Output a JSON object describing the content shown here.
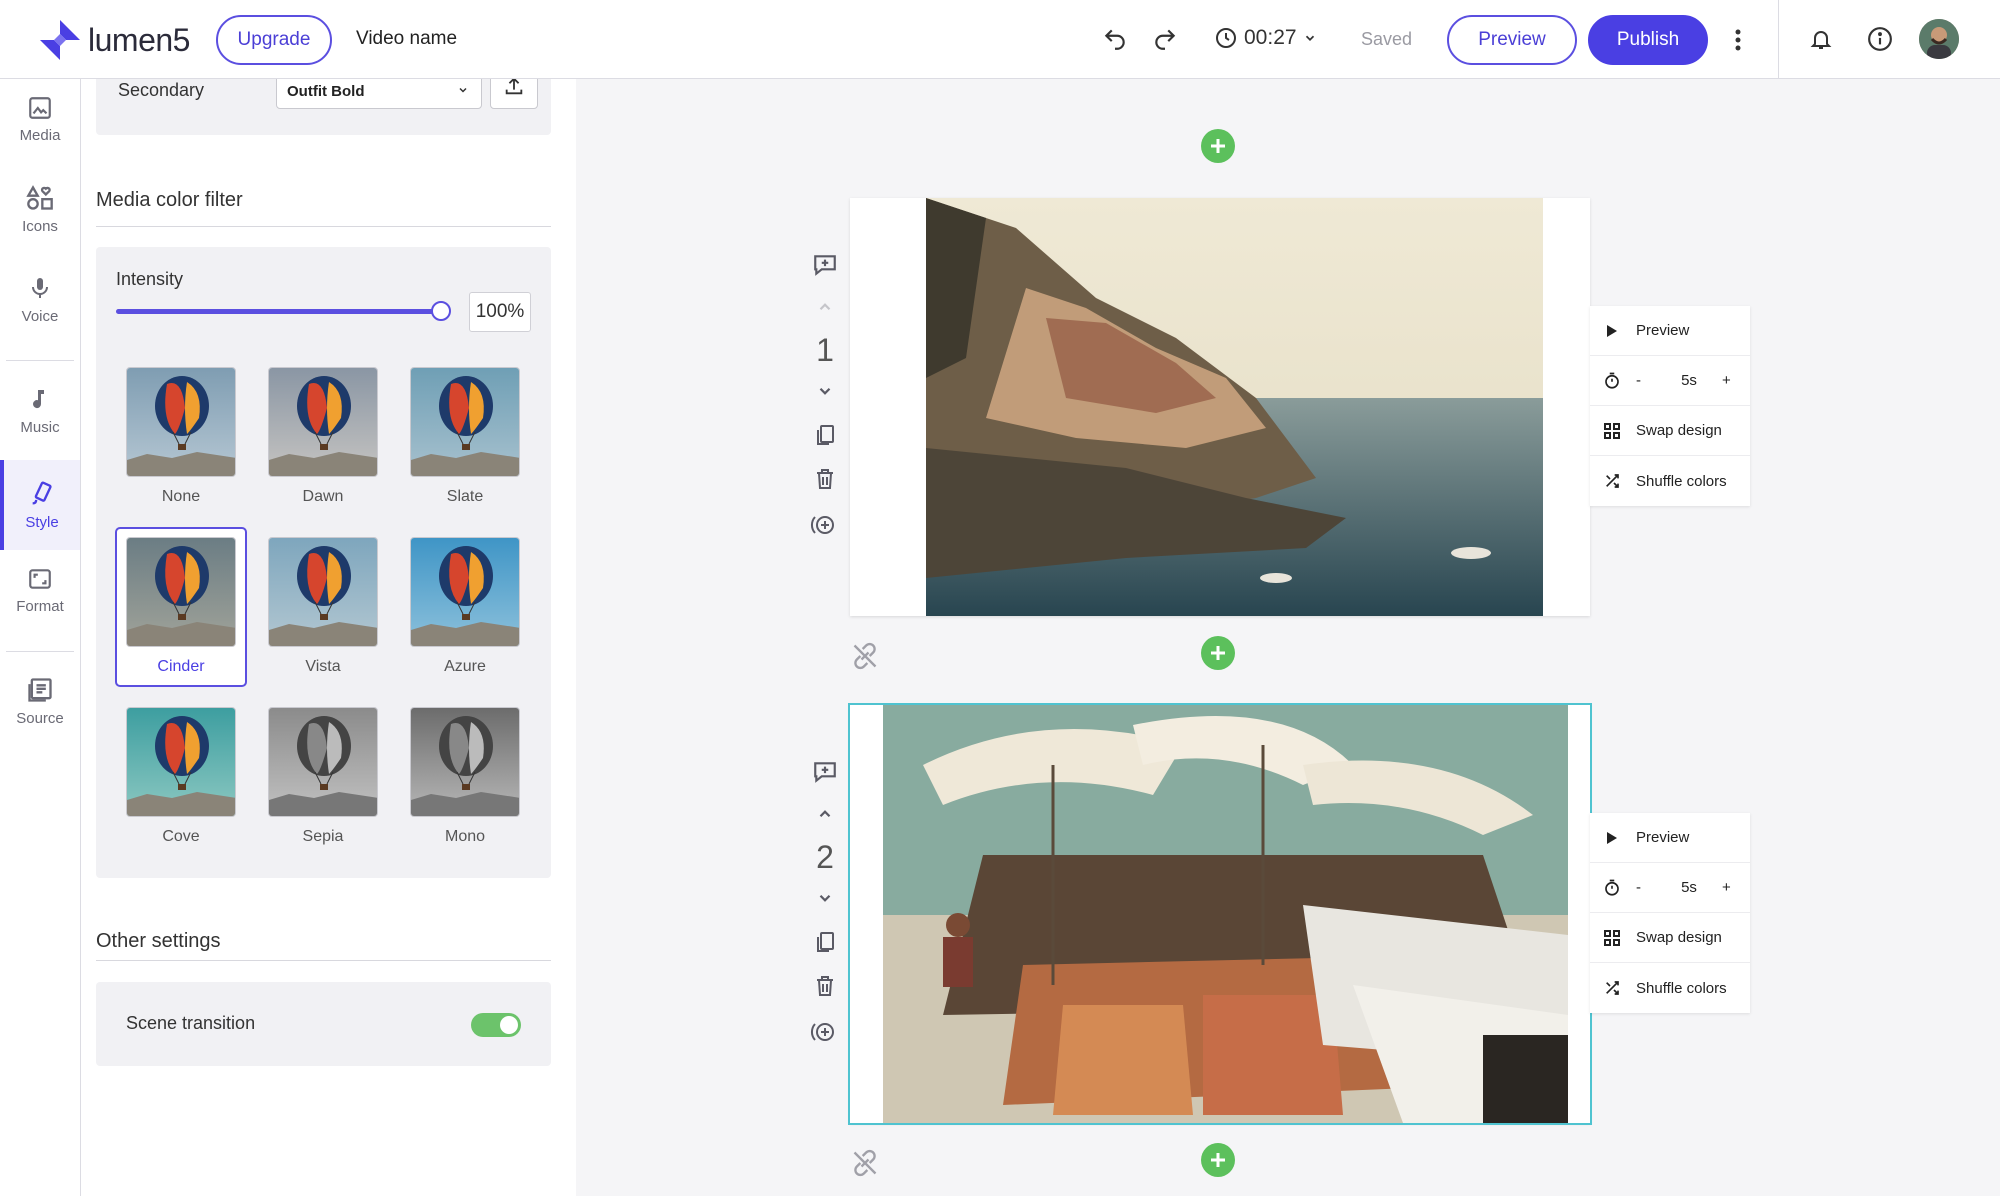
{
  "header": {
    "brand": "lumen5",
    "upgrade_label": "Upgrade",
    "video_name": "Video name",
    "duration": "00:27",
    "saved_label": "Saved",
    "preview_label": "Preview",
    "publish_label": "Publish"
  },
  "rail": {
    "items": [
      {
        "label": "Media",
        "icon": "image-icon"
      },
      {
        "label": "Icons",
        "icon": "shapes-icon"
      },
      {
        "label": "Voice",
        "icon": "microphone-icon"
      },
      {
        "label": "Music",
        "icon": "music-note-icon"
      },
      {
        "label": "Style",
        "icon": "brush-icon"
      },
      {
        "label": "Format",
        "icon": "aspect-ratio-icon"
      },
      {
        "label": "Source",
        "icon": "document-icon"
      }
    ],
    "active": "Style"
  },
  "panel": {
    "secondary_label": "Secondary",
    "secondary_font": "Outfit Bold",
    "media_filter_title": "Media color filter",
    "intensity_label": "Intensity",
    "intensity_value": "100%",
    "intensity_fraction": 1.0,
    "filters": [
      {
        "name": "None"
      },
      {
        "name": "Dawn"
      },
      {
        "name": "Slate"
      },
      {
        "name": "Cinder"
      },
      {
        "name": "Vista"
      },
      {
        "name": "Azure"
      },
      {
        "name": "Cove"
      },
      {
        "name": "Sepia"
      },
      {
        "name": "Mono"
      }
    ],
    "selected_filter": "Cinder",
    "other_settings_title": "Other settings",
    "scene_transition_label": "Scene transition",
    "scene_transition_on": true
  },
  "scenes": [
    {
      "number": "1",
      "menu": {
        "preview": "Preview",
        "minus": "-",
        "duration": "5s",
        "plus": "+",
        "swap": "Swap design",
        "shuffle": "Shuffle colors"
      }
    },
    {
      "number": "2",
      "menu": {
        "preview": "Preview",
        "minus": "-",
        "duration": "5s",
        "plus": "+",
        "swap": "Swap design",
        "shuffle": "Shuffle colors"
      }
    }
  ],
  "colors": {
    "accent": "#4a3fe3",
    "add_green": "#5cc05c",
    "selection": "#4fc3d0",
    "toggle_on": "#6cc36b"
  }
}
